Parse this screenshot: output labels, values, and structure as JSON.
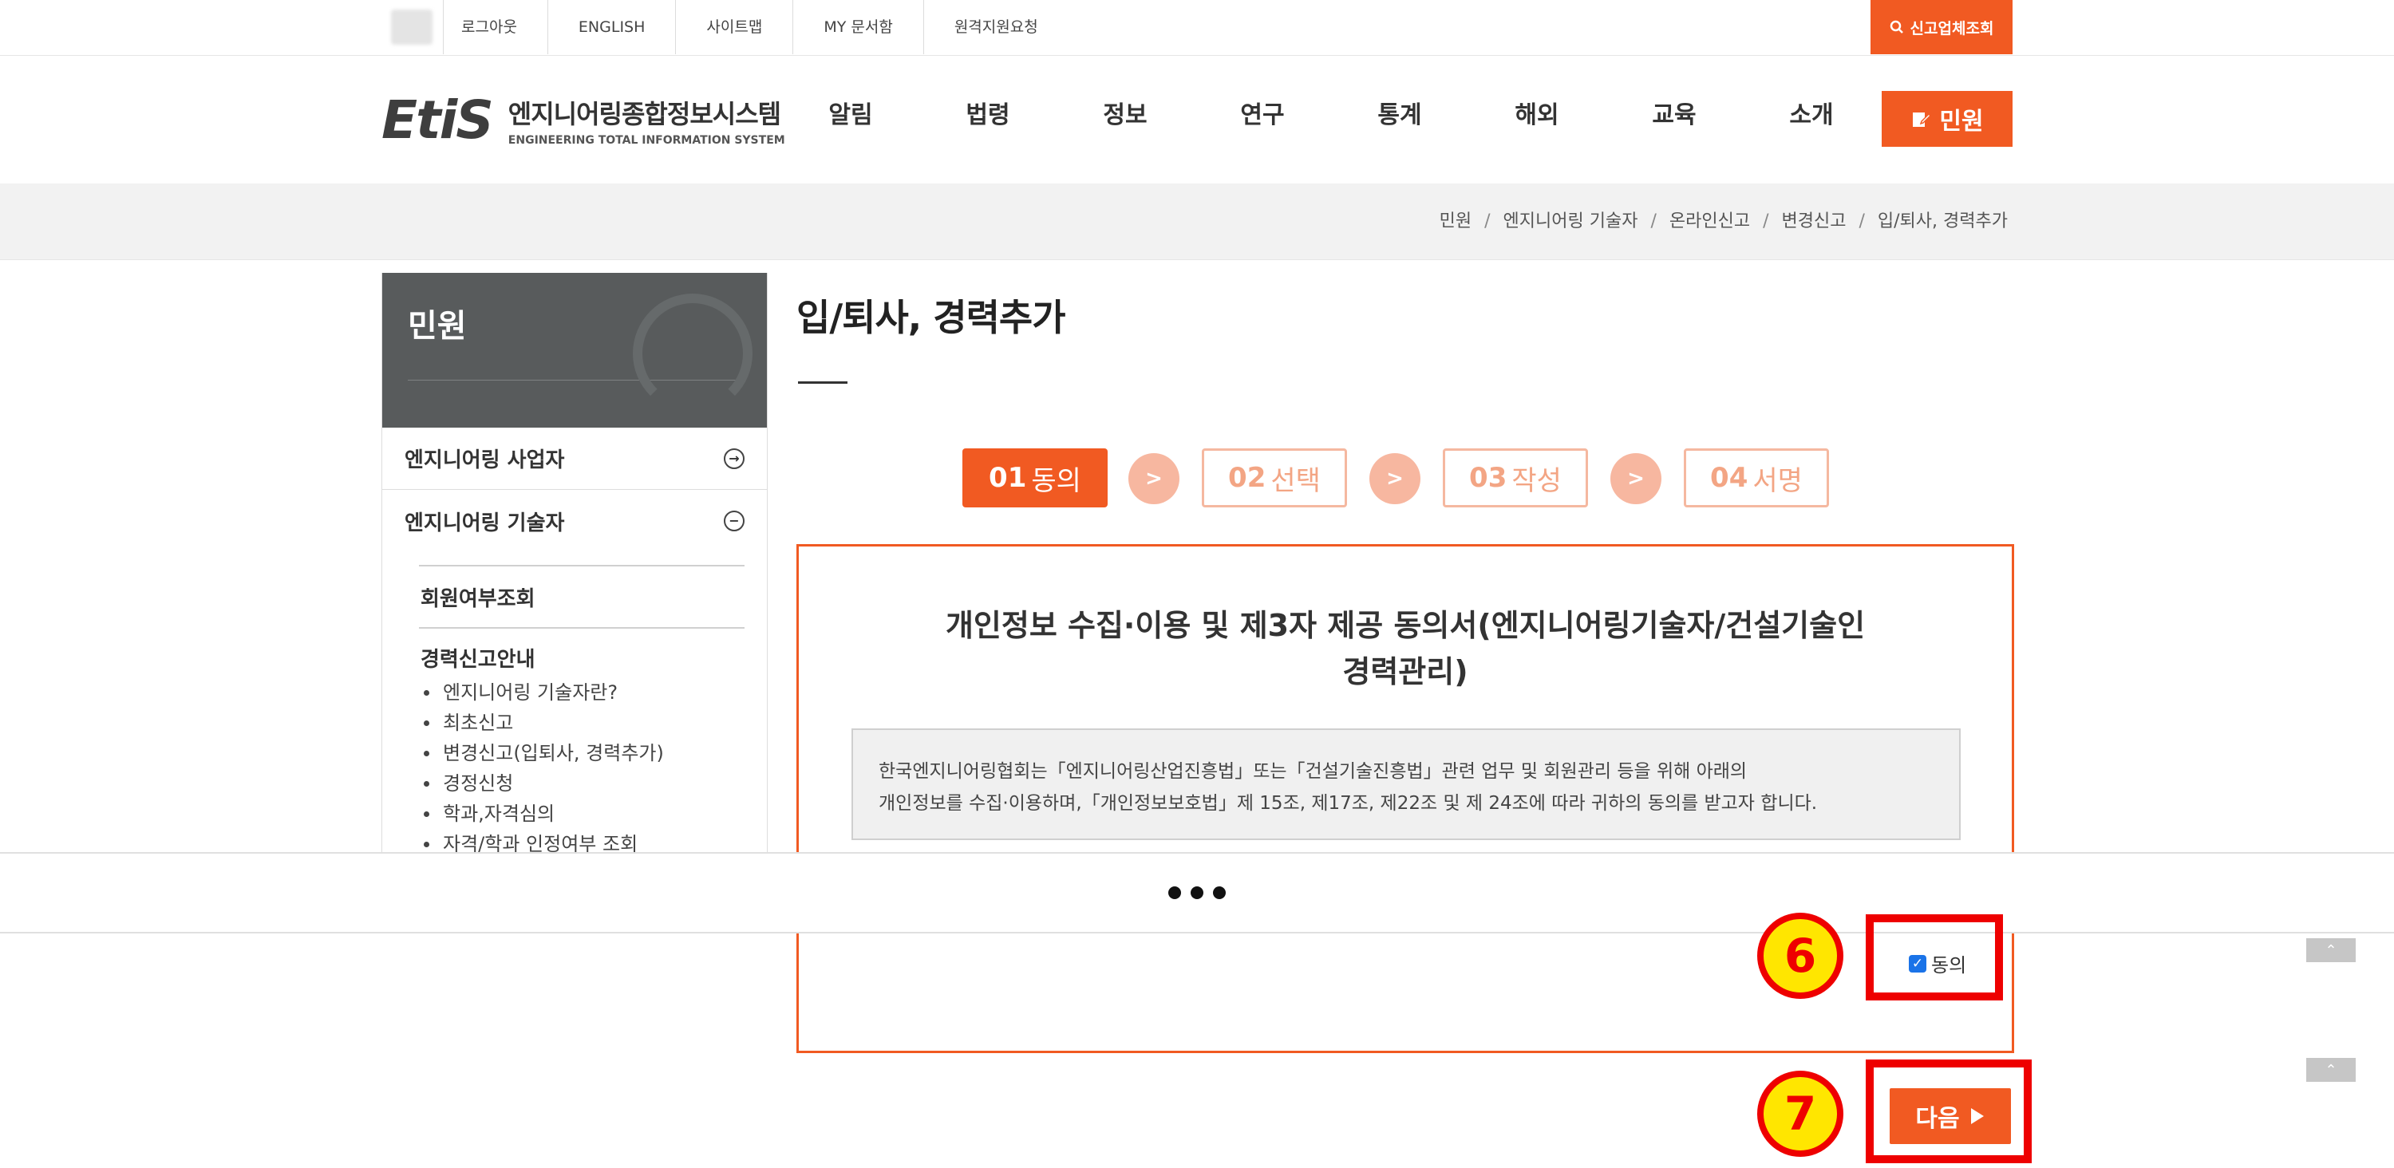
{
  "util": {
    "links": [
      "로그아웃",
      "ENGLISH",
      "사이트맵",
      "MY 문서함",
      "원격지원요청"
    ],
    "search_label": "신고업체조회"
  },
  "header": {
    "logo_mark": "EtiS",
    "logo_ko": "엔지니어링종합정보시스템",
    "logo_en": "ENGINEERING TOTAL INFORMATION SYSTEM",
    "nav": [
      "알림",
      "법령",
      "정보",
      "연구",
      "통계",
      "해외",
      "교육",
      "소개"
    ],
    "civil_button": "민원"
  },
  "breadcrumb": [
    "민원",
    "엔지니어링 기술자",
    "온라인신고",
    "변경신고",
    "입/퇴사, 경력추가"
  ],
  "sidebar": {
    "title": "민원",
    "items": [
      {
        "label": "엔지니어링 사업자",
        "icon": "→"
      },
      {
        "label": "엔지니어링 기술자",
        "icon": "−"
      }
    ],
    "sub_first": "회원여부조회",
    "sub_group": "경력신고안내",
    "sub_list": [
      "엔지니어링 기술자란?",
      "최초신고",
      "변경신고(입퇴사, 경력추가)",
      "경정신청",
      "학과,자격심의",
      "자격/학과 인정여부 조회"
    ]
  },
  "main": {
    "title": "입/퇴사, 경력추가",
    "steps": [
      {
        "num": "01",
        "label": "동의"
      },
      {
        "num": "02",
        "label": "선택"
      },
      {
        "num": "03",
        "label": "작성"
      },
      {
        "num": "04",
        "label": "서명"
      }
    ],
    "arrow": ">",
    "agree_title_1": "개인정보 수집·이용 및 제3자 제공 동의서(엔지니어링기술자/건설기술인",
    "agree_title_2": "경력관리)",
    "agree_text_1": "한국엔지니어링협회는「엔지니어링산업진흥법」또는「건설기술진흥법」관련 업무 및 회원관리 등을 위해 아래의",
    "agree_text_2": "개인정보를 수집·이용하며,「개인정보보호법」제 15조, 제17조, 제22조 및 제 24조에 따라 귀하의 동의를 받고자 합니다.",
    "agree_label": "동의",
    "next_button": "다음"
  },
  "annotations": {
    "badge_6": "6",
    "badge_7": "7",
    "frame_color": "#ee0000",
    "badge_color": "#ffe600"
  },
  "colors": {
    "accent": "#f15a22",
    "sidebar_head": "#585b5c"
  },
  "states": {
    "agree_checked": true,
    "active_step": 1
  }
}
